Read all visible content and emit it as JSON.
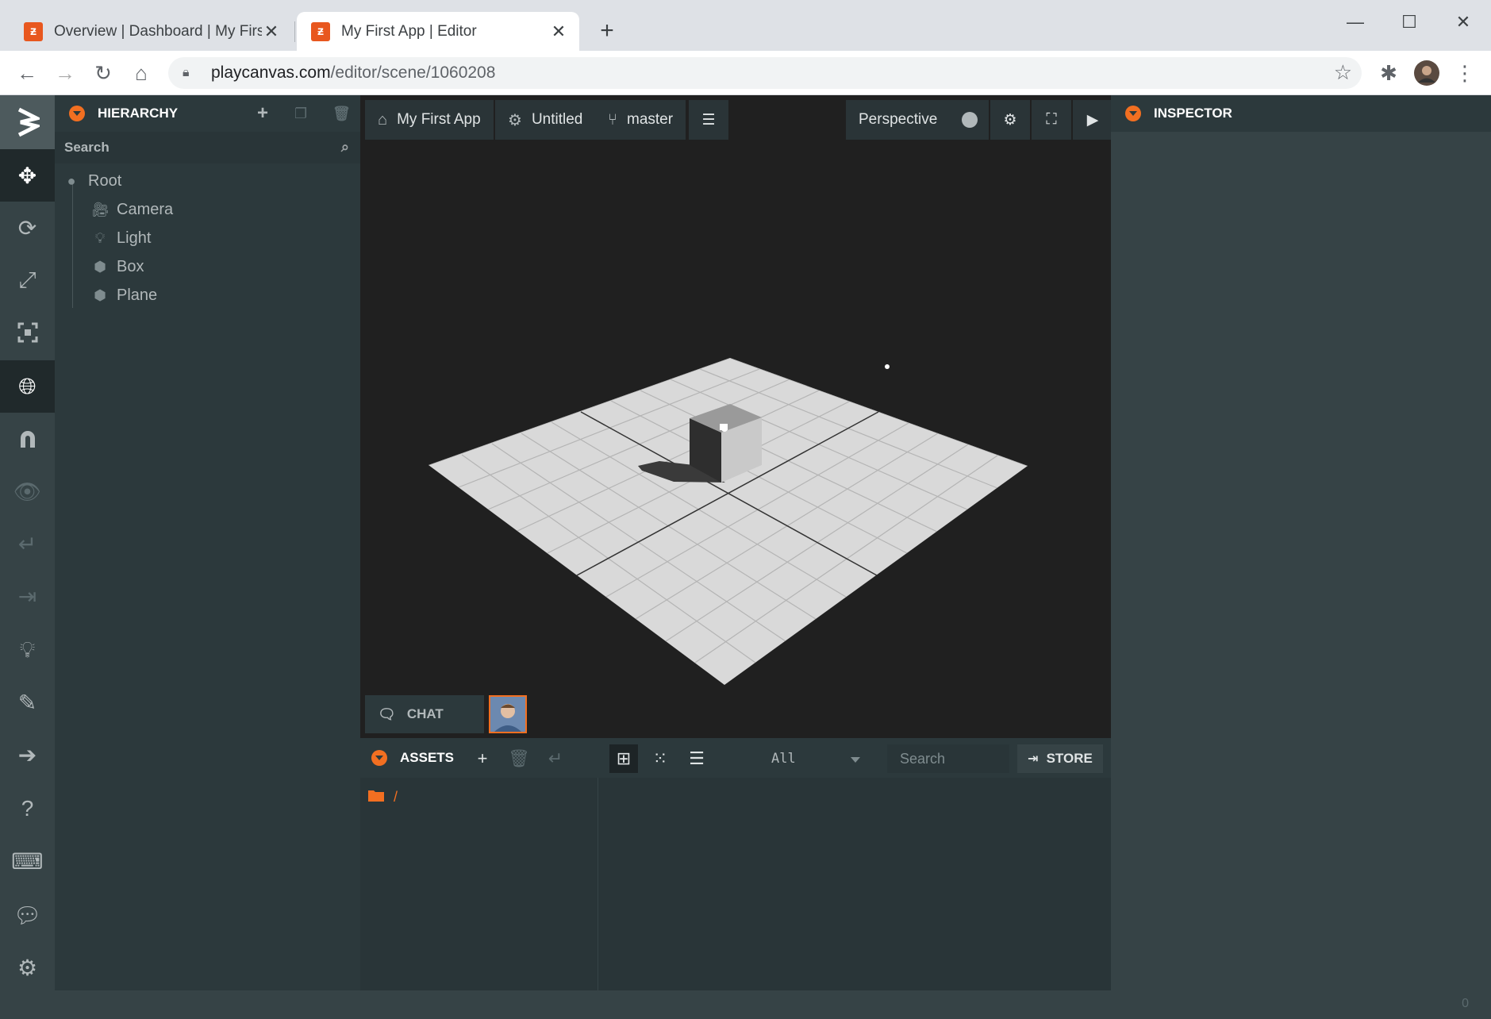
{
  "browser": {
    "tabs": [
      {
        "title": "Overview | Dashboard | My First App",
        "active": false
      },
      {
        "title": "My First App | Editor",
        "active": true
      }
    ],
    "url_host": "playcanvas.com",
    "url_path": "/editor/scene/1060208"
  },
  "hierarchy": {
    "title": "HIERARCHY",
    "search_placeholder": "Search",
    "items": [
      {
        "label": "Root",
        "icon": "root-dot-icon",
        "depth": 0
      },
      {
        "label": "Camera",
        "icon": "camera-icon",
        "depth": 1
      },
      {
        "label": "Light",
        "icon": "light-icon",
        "depth": 1
      },
      {
        "label": "Box",
        "icon": "box-icon",
        "depth": 1
      },
      {
        "label": "Plane",
        "icon": "box-icon",
        "depth": 1
      }
    ]
  },
  "viewport": {
    "project_label": "My First App",
    "scene_label": "Untitled",
    "branch_label": "master",
    "camera_mode": "Perspective"
  },
  "inspector": {
    "title": "INSPECTOR"
  },
  "chat": {
    "label": "CHAT"
  },
  "assets": {
    "title": "ASSETS",
    "filter_value": "All",
    "search_placeholder": "Search",
    "store_label": "STORE",
    "root_folder": "/"
  },
  "status": {
    "count": "0"
  },
  "colors": {
    "accent": "#f26f21",
    "panel": "#2c393c",
    "viewport_bg": "#202020"
  }
}
